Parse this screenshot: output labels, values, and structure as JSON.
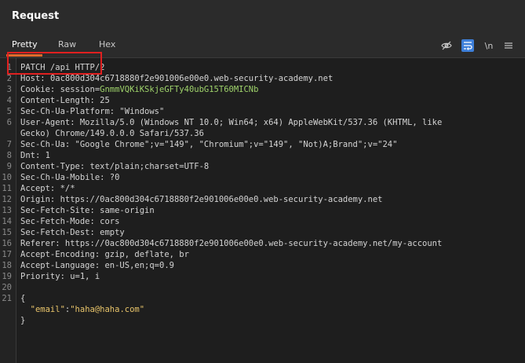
{
  "panel": {
    "title": "Request"
  },
  "tabs": [
    {
      "label": "Pretty",
      "active": true
    },
    {
      "label": "Raw",
      "active": false
    },
    {
      "label": "Hex",
      "active": false
    }
  ],
  "toolbar": {
    "icons": [
      "hide-icon",
      "wrap-icon",
      "newline-icon",
      "menu-icon"
    ],
    "newline_label": "\\n",
    "accent": "#3d7fd9"
  },
  "request_lines": [
    {
      "n": "1",
      "parts": [
        {
          "t": "PATCH /api HTTP/2",
          "c": "hk"
        }
      ]
    },
    {
      "n": "2",
      "parts": [
        {
          "t": "Host: ",
          "c": "hk"
        },
        {
          "t": "0ac800d304c6718880f2e901006e00e0.web-security-academy.net",
          "c": "hv"
        }
      ]
    },
    {
      "n": "3",
      "parts": [
        {
          "t": "Cookie: ",
          "c": "hk"
        },
        {
          "t": "session=",
          "c": "hv"
        },
        {
          "t": "GnmmVQKiKSkjeGFTy40ubG15T60MICNb",
          "c": "cookie-val"
        }
      ]
    },
    {
      "n": "4",
      "parts": [
        {
          "t": "Content-Length: 25",
          "c": "hk"
        }
      ]
    },
    {
      "n": "5",
      "parts": [
        {
          "t": "Sec-Ch-Ua-Platform: \"Windows\"",
          "c": "hk"
        }
      ]
    },
    {
      "n": "6",
      "parts": [
        {
          "t": "User-Agent: Mozilla/5.0 (Windows NT 10.0; Win64; x64) AppleWebKit/537.36 (KHTML, like",
          "c": "hk"
        }
      ]
    },
    {
      "n": "",
      "parts": [
        {
          "t": "Gecko) Chrome/149.0.0.0 Safari/537.36",
          "c": "hk"
        }
      ]
    },
    {
      "n": "7",
      "parts": [
        {
          "t": "Sec-Ch-Ua: \"Google Chrome\";v=\"149\", \"Chromium\";v=\"149\", \"Not)A;Brand\";v=\"24\"",
          "c": "hk"
        }
      ]
    },
    {
      "n": "8",
      "parts": [
        {
          "t": "Dnt: 1",
          "c": "hk"
        }
      ]
    },
    {
      "n": "9",
      "parts": [
        {
          "t": "Content-Type: text/plain;charset=UTF-8",
          "c": "hk"
        }
      ]
    },
    {
      "n": "10",
      "parts": [
        {
          "t": "Sec-Ch-Ua-Mobile: ?0",
          "c": "hk"
        }
      ]
    },
    {
      "n": "11",
      "parts": [
        {
          "t": "Accept: */*",
          "c": "hk"
        }
      ]
    },
    {
      "n": "12",
      "parts": [
        {
          "t": "Origin: https://0ac800d304c6718880f2e901006e00e0.web-security-academy.net",
          "c": "hk"
        }
      ]
    },
    {
      "n": "13",
      "parts": [
        {
          "t": "Sec-Fetch-Site: same-origin",
          "c": "hk"
        }
      ]
    },
    {
      "n": "14",
      "parts": [
        {
          "t": "Sec-Fetch-Mode: cors",
          "c": "hk"
        }
      ]
    },
    {
      "n": "15",
      "parts": [
        {
          "t": "Sec-Fetch-Dest: empty",
          "c": "hk"
        }
      ]
    },
    {
      "n": "16",
      "parts": [
        {
          "t": "Referer: https://0ac800d304c6718880f2e901006e00e0.web-security-academy.net/my-account",
          "c": "hk"
        }
      ]
    },
    {
      "n": "17",
      "parts": [
        {
          "t": "Accept-Encoding: gzip, deflate, br",
          "c": "hk"
        }
      ]
    },
    {
      "n": "18",
      "parts": [
        {
          "t": "Accept-Language: en-US,en;q=0.9",
          "c": "hk"
        }
      ]
    },
    {
      "n": "19",
      "parts": [
        {
          "t": "Priority: u=1, i",
          "c": "hk"
        }
      ]
    },
    {
      "n": "20",
      "parts": []
    },
    {
      "n": "21",
      "parts": [
        {
          "t": "{",
          "c": "hk"
        }
      ]
    },
    {
      "n": "",
      "parts": [
        {
          "t": "  \"email\"",
          "c": "json-key"
        },
        {
          "t": ":",
          "c": "hk"
        },
        {
          "t": "\"haha@haha.com\"",
          "c": "json-str"
        }
      ]
    },
    {
      "n": "",
      "parts": [
        {
          "t": "}",
          "c": "hk"
        }
      ]
    }
  ]
}
